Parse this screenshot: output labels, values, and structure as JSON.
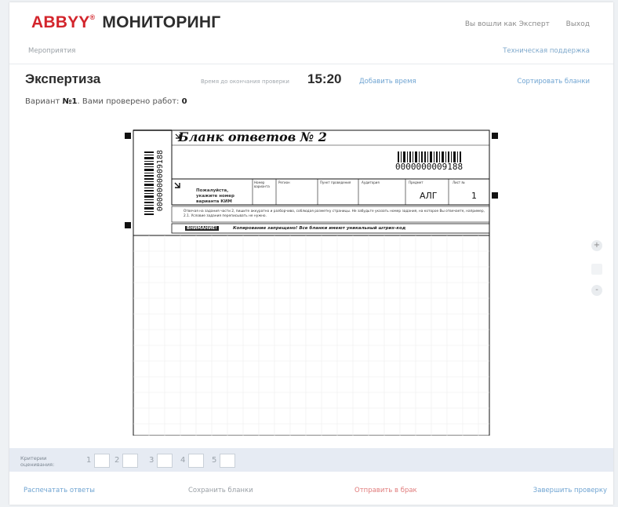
{
  "header": {
    "brand": "ABBYY",
    "product": "МОНИТОРИНГ",
    "logged_in": "Вы вошли как Эксперт",
    "exit": "Выход"
  },
  "subnav": {
    "events": "Мероприятия",
    "support": "Техническая поддержка"
  },
  "title_bar": {
    "title": "Экспертиза",
    "time_left_label": "Время до окончания проверки",
    "time_left": "15:20",
    "add_time": "Добавить время",
    "sort": "Сортировать бланки"
  },
  "variant": {
    "prefix": "Вариант ",
    "number": "№1",
    "middle": ". Вами проверено работ: ",
    "checked": "0"
  },
  "sheet": {
    "title": "Бланк ответов № 2",
    "barcode": "0000000009188",
    "side_barcode": "0000000009188",
    "field_note": "Пожалуйста, укажите номер варианта КИМ",
    "columns": [
      "Номер варианта",
      "Регион",
      "Пункт проведения",
      "Аудитория",
      "Предмет",
      "Лист №"
    ],
    "subject": "АЛГ",
    "page": "1",
    "instruction": "Отвечая на задания части 2, пишите аккуратно и разборчиво, соблюдая разметку страницы. Не забудьте указать номер задания, на которое Вы отвечаете, например, 2.1. Условие задания переписывать не нужно.",
    "warning_label": "ВНИМАНИЕ!",
    "warning": "Копирование запрещено! Все бланки имеют уникальный штрих-код"
  },
  "zoom": {
    "in": "+",
    "out": "-"
  },
  "criteria": {
    "label": "Критерии\nоценивания:",
    "items": [
      "1",
      "2",
      "3",
      "4",
      "5"
    ]
  },
  "footer": {
    "print": "Распечатать ответы",
    "save": "Сохранить бланки",
    "reject": "Отправить в брак",
    "finish": "Завершить проверку"
  }
}
